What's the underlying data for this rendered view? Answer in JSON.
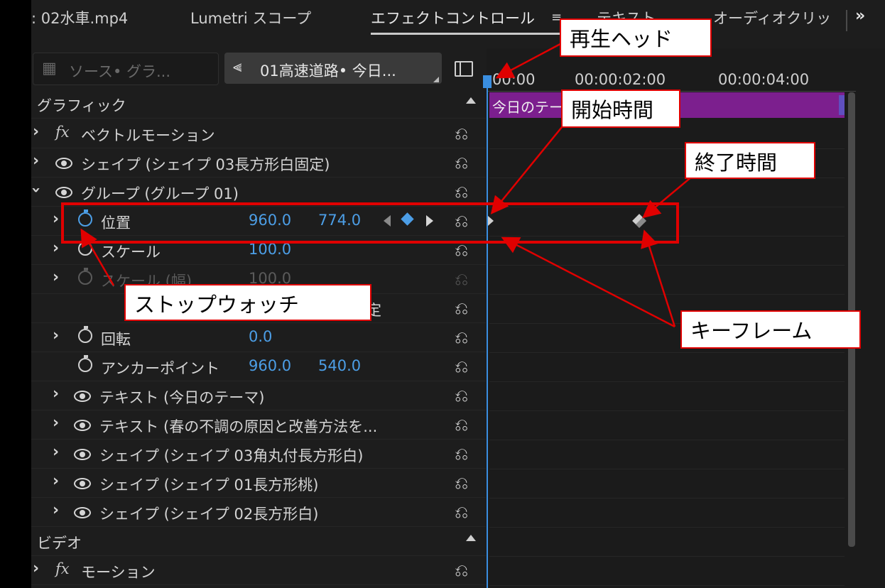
{
  "tabs": [
    {
      "label": ": 02水車.mp4"
    },
    {
      "label": "Lumetri スコープ"
    },
    {
      "label": "エフェクトコントロール"
    },
    {
      "label": "テキスト"
    },
    {
      "label": "オーディオクリッ"
    }
  ],
  "tab_menu_icon": "hamburger-icon",
  "tab_overflow": "»",
  "source": {
    "left_label": "ソース• グラ...",
    "right_label": "01高速道路• 今日..."
  },
  "rows": {
    "graphic_section": "グラフィック",
    "vector_motion": "ベクトルモーション",
    "shape_03_rect_white_fixed": "シェイプ (シェイプ 03長方形白固定)",
    "group_01": "グループ (グループ 01)",
    "position": {
      "label": "位置",
      "x": "960.0",
      "y": "774.0"
    },
    "scale": {
      "label": "スケール",
      "value": "100.0"
    },
    "scale_width": {
      "label": "スケール (幅)",
      "value": "100.0"
    },
    "uniform_scale_tail": "定",
    "rotation": {
      "label": "回転",
      "value": "0.0"
    },
    "anchor_point": {
      "label": "アンカーポイント",
      "x": "960.0",
      "y": "540.0"
    },
    "text_theme": "テキスト (今日のテーマ)",
    "text_spring": "テキスト (春の不調の原因と改善方法を...",
    "shape_03_rounded": "シェイプ (シェイプ 03角丸付長方形白)",
    "shape_01_peach": "シェイプ (シェイプ 01長方形桃)",
    "shape_02_white": "シェイプ (シェイプ 02長方形白)",
    "video_section": "ビデオ",
    "motion": "モーション"
  },
  "timeline": {
    "ruler": [
      "00:00",
      "00:00:02:00",
      "00:00:04:00"
    ],
    "clip_label": "今日のテーマ"
  },
  "annotations": {
    "playhead": "再生ヘッド",
    "start_time": "開始時間",
    "end_time": "終了時間",
    "stopwatch": "ストップウォッチ",
    "keyframe": "キーフレーム"
  },
  "colors": {
    "accent_blue": "#4c9ee6",
    "clip_purple": "#7c1f8e",
    "annotation_red": "#e00000"
  }
}
